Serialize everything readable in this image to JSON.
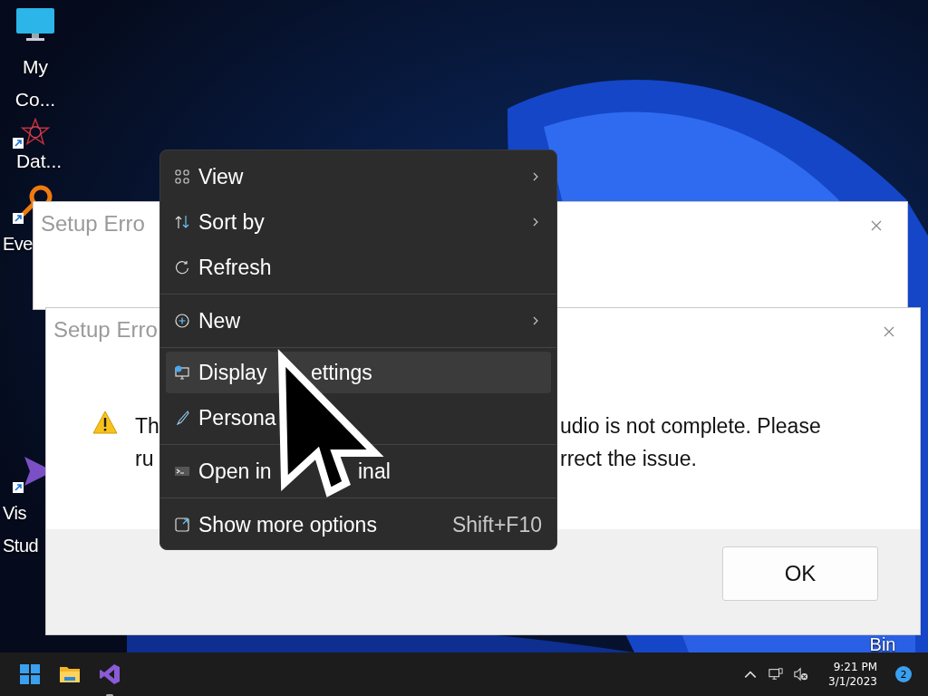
{
  "desktop_icons": [
    {
      "label_lines": [
        "My",
        "Co..."
      ],
      "shortcut": false
    },
    {
      "label_lines": [
        "Dat..."
      ],
      "shortcut": true
    },
    {
      "label_lines": [
        "Eve"
      ],
      "shortcut": true
    },
    {
      "label_lines": [
        "Vis",
        "Stud"
      ],
      "shortcut": true
    },
    {
      "label_lines": [
        "Bin"
      ]
    }
  ],
  "dialogs": [
    {
      "title": "Setup Erro"
    },
    {
      "title": "Setup Erro",
      "message_left": [
        "Th",
        "ru"
      ],
      "message_right": [
        "udio is not complete. Please",
        "rrect the issue."
      ],
      "button": "OK"
    }
  ],
  "context_menu": {
    "groups": [
      [
        {
          "label": "View",
          "submenu": true,
          "selected": false
        },
        {
          "label": "Sort by",
          "submenu": true,
          "selected": false
        },
        {
          "label": "Refresh",
          "submenu": false,
          "selected": false
        }
      ],
      [
        {
          "label": "New",
          "submenu": true,
          "selected": false
        }
      ],
      [
        {
          "label": "Display",
          "tail": "ettings",
          "submenu": false,
          "selected": true
        },
        {
          "label": "Persona",
          "submenu": false,
          "selected": false
        }
      ],
      [
        {
          "label": "Open in",
          "tail": "inal",
          "submenu": false,
          "selected": false
        }
      ],
      [
        {
          "label": "Show more options",
          "shortcut": "Shift+F10",
          "submenu": false,
          "selected": false
        }
      ]
    ]
  },
  "taskbar": {
    "apps": [
      {
        "running": false
      },
      {
        "running": false
      },
      {
        "running": true
      }
    ],
    "time": "9:21 PM",
    "date": "3/1/2023",
    "notifications": "2"
  }
}
